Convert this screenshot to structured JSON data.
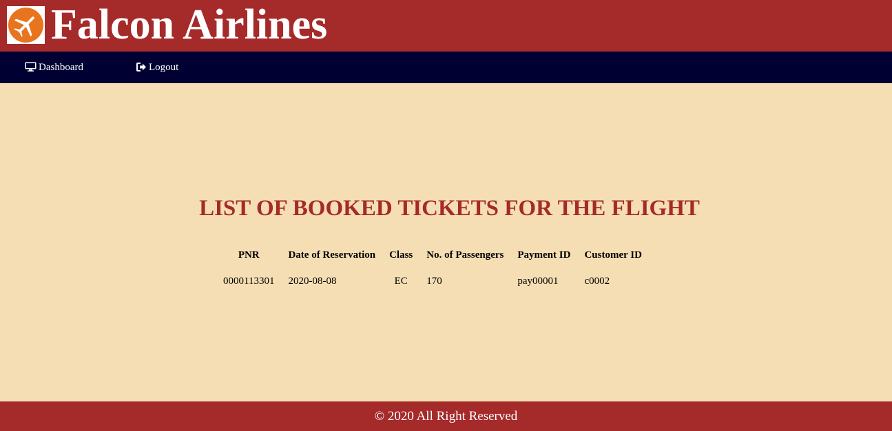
{
  "header": {
    "brand": "Falcon Airlines",
    "logo_icon": "airplane-icon",
    "brand_color": "#a52a2a",
    "logo_color": "#e8741e"
  },
  "nav": {
    "items": [
      {
        "label": "Dashboard",
        "icon": "monitor-icon"
      },
      {
        "label": "Logout",
        "icon": "sign-out-icon"
      }
    ],
    "background": "#000033"
  },
  "main": {
    "title": "LIST OF BOOKED TICKETS FOR THE FLIGHT",
    "table": {
      "headers": [
        "PNR",
        "Date of Reservation",
        "Class",
        "No. of Passengers",
        "Payment ID",
        "Customer ID"
      ],
      "rows": [
        [
          "0000113301",
          "2020-08-08",
          "EC",
          "170",
          "pay00001",
          "c0002"
        ]
      ]
    },
    "background": "#f5deb3"
  },
  "footer": {
    "text": "© 2020 All Right Reserved"
  }
}
